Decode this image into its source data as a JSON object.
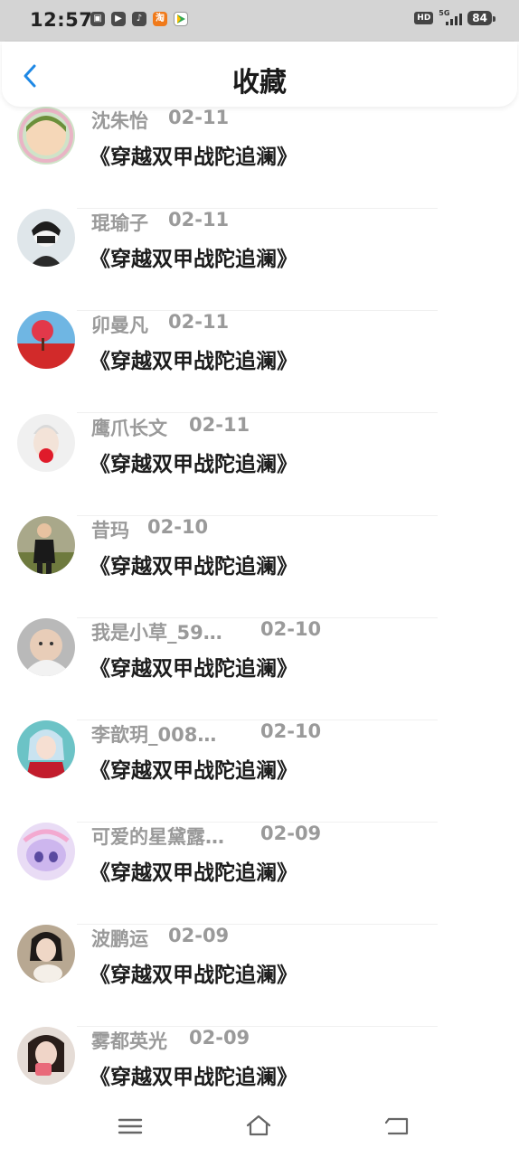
{
  "status_bar": {
    "time": "12:57",
    "notification_icons": [
      "gallery-icon",
      "video-icon",
      "tiktok-icon",
      "taobao-icon",
      "play-icon"
    ],
    "taobao_label": "淘",
    "hd_label": "HD",
    "network_label": "5G",
    "battery": "84"
  },
  "header": {
    "title": "收藏"
  },
  "favorites": [
    {
      "user": "沈朱怡",
      "date": "02-11",
      "title": "《穿越双甲战陀追澜》"
    },
    {
      "user": "琨瑜子",
      "date": "02-11",
      "title": "《穿越双甲战陀追澜》"
    },
    {
      "user": "卯曼凡",
      "date": "02-11",
      "title": "《穿越双甲战陀追澜》"
    },
    {
      "user": "鹰爪长文",
      "date": "02-11",
      "title": "《穿越双甲战陀追澜》"
    },
    {
      "user": "昔玛",
      "date": "02-10",
      "title": "《穿越双甲战陀追澜》"
    },
    {
      "user": "我是小草_59…",
      "date": "02-10",
      "title": "《穿越双甲战陀追澜》"
    },
    {
      "user": "李歆玥_008…",
      "date": "02-10",
      "title": "《穿越双甲战陀追澜》"
    },
    {
      "user": "可爱的星黛露…",
      "date": "02-09",
      "title": "《穿越双甲战陀追澜》"
    },
    {
      "user": "波鹏运",
      "date": "02-09",
      "title": "《穿越双甲战陀追澜》"
    },
    {
      "user": "雾都英光",
      "date": "02-09",
      "title": "《穿越双甲战陀追澜》"
    }
  ],
  "colors": {
    "accent": "#1e88e5",
    "meta_text": "#9a9a9a",
    "title_text": "#1c1c1c",
    "status_bar_bg": "#d4d4d4"
  },
  "system_nav": [
    "menu-icon",
    "home-icon",
    "back-icon"
  ]
}
